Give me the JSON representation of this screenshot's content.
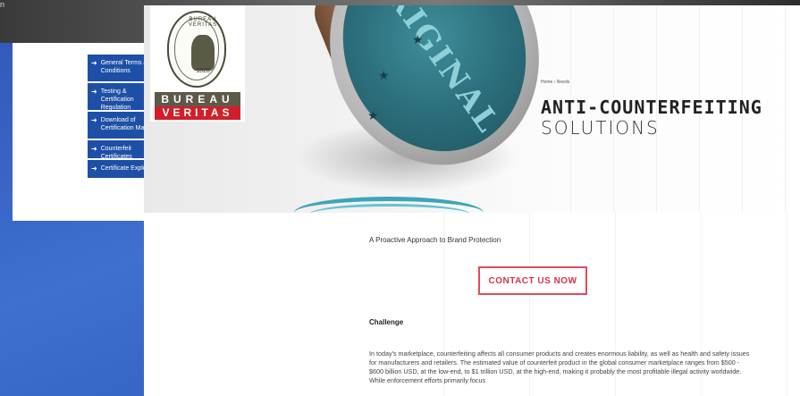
{
  "background": {
    "corner_text": "n"
  },
  "left_menu": {
    "items": [
      {
        "label": "General Terms & Conditions",
        "icon": "arrow-right-icon"
      },
      {
        "label": "Testing & Certification Regulation",
        "icon": "arrow-right-icon"
      },
      {
        "label": "Download of Certification Marks",
        "icon": "arrow-right-icon"
      },
      {
        "label": "Counterfeit Certificates",
        "icon": "arrow-right-icon"
      },
      {
        "label": "Certificate Explorer",
        "icon": "arrow-right-icon"
      }
    ]
  },
  "logo": {
    "seal_top": "BUREAU VERITAS",
    "seal_year": "1828",
    "band_top": "BUREAU",
    "band_bottom": "VERITAS",
    "colors": {
      "band_top": "#5e5a4a",
      "band_bottom": "#d11f2a"
    }
  },
  "hero": {
    "stamp_text": "ORIGINAL",
    "breadcrumb": "Home  ›  Needs",
    "title": "ANTI-COUNTERFEITING",
    "subtitle": "SOLUTIONS"
  },
  "content": {
    "tagline": "A Proactive Approach to Brand Protection",
    "contact_button": "CONTACT US NOW",
    "section_heading": "Challenge",
    "paragraph": "In today's marketplace, counterfeiting affects all consumer products and creates enormous liability, as well as health and safety issues for manufacturers and retailers. The estimated value of counterfeit product in the global consumer marketplace ranges from $500 - $600 billion USD, at the low-end, to $1 trillion USD, at the high-end, making it probably the most profitable illegal activity worldwide. While enforcement efforts primarily focus"
  },
  "colors": {
    "accent_red": "#e24a5c",
    "menu_blue": "#1e4fa6",
    "background_blue": "#3f6fd0"
  }
}
